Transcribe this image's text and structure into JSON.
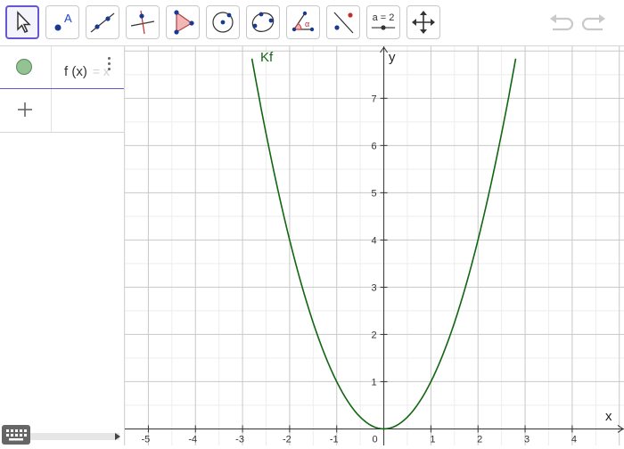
{
  "toolbar": {
    "tools": [
      {
        "name": "move-tool"
      },
      {
        "name": "point-tool",
        "label": "A"
      },
      {
        "name": "line-tool"
      },
      {
        "name": "perpendicular-line-tool"
      },
      {
        "name": "polygon-tool"
      },
      {
        "name": "circle-center-point-tool"
      },
      {
        "name": "circle-three-points-tool"
      },
      {
        "name": "angle-tool",
        "label": "α"
      },
      {
        "name": "reflect-about-line-tool"
      },
      {
        "name": "slider-tool",
        "label": "a = 2"
      },
      {
        "name": "move-graphics-view-tool"
      }
    ],
    "active_tool": "move-tool",
    "accent_color": "#6557d2"
  },
  "algebra": {
    "items": [
      {
        "expression": "f (x)",
        "suffix": "= x",
        "visible": true,
        "color": "#93c393"
      }
    ],
    "add_label": "+"
  },
  "graphics": {
    "curve_label": "Kf",
    "curve_color": "#116611",
    "x_axis_label": "x",
    "y_axis_label": "y"
  },
  "chart_data": {
    "type": "line",
    "title": "",
    "xlabel": "x",
    "ylabel": "y",
    "xlim": [
      -5.5,
      5.1
    ],
    "ylim": [
      -0.35,
      8.1
    ],
    "grid": true,
    "x_ticks": [
      "-5",
      "-4",
      "-3",
      "-2",
      "-1",
      "0",
      "1",
      "2",
      "3",
      "4"
    ],
    "y_ticks": [
      "1",
      "2",
      "3",
      "4",
      "5",
      "6",
      "7"
    ],
    "series": [
      {
        "name": "Kf",
        "color": "#116611",
        "x": [
          -2.8,
          -2.5,
          -2,
          -1.5,
          -1,
          -0.5,
          0,
          0.5,
          1,
          1.5,
          2,
          2.5,
          2.8
        ],
        "y": [
          7.84,
          6.25,
          4,
          2.25,
          1,
          0.25,
          0,
          0.25,
          1,
          2.25,
          4,
          6.25,
          7.84
        ]
      }
    ]
  }
}
